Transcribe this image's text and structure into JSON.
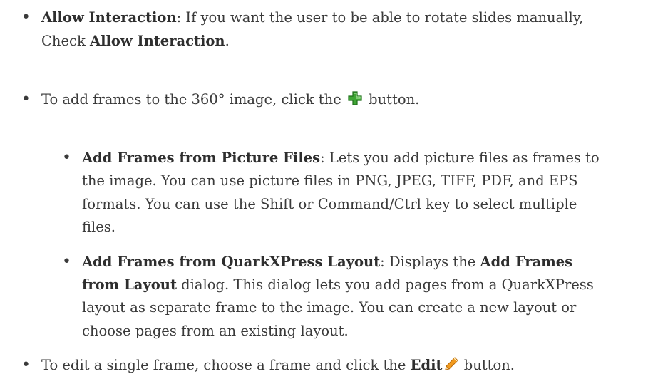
{
  "bullets": {
    "allow_interaction": {
      "label": "Allow Interaction",
      "text_a": ": If you want the user to be able to rotate slides manually,",
      "text_b": "Check ",
      "label2": "Allow Interaction",
      "text_c": "."
    },
    "add_frames": {
      "text_a": "To add frames to the 360° image, click the ",
      "icon": "green-plus-icon",
      "text_b": " button."
    },
    "from_picture_files": {
      "label": "Add Frames from Picture Files",
      "lines": [
        ": Lets you add picture files as frames to",
        "the image. You can use picture files in PNG, JPEG, TIFF, PDF, and EPS",
        "formats. You can use the Shift or Command/Ctrl key to select multiple",
        "files."
      ]
    },
    "from_layout": {
      "label": "Add Frames from QuarkXPress Layout",
      "text_a": ": Displays the ",
      "label2_line1": "Add Frames",
      "label2_line2": "from Layout",
      "text_b": " dialog. This dialog lets you add pages from a QuarkXPress",
      "lines": [
        "layout as separate frame to the image. You can create a new layout or",
        "choose pages from an existing layout."
      ]
    },
    "edit_frame": {
      "text_a": "To edit a single frame, choose a frame and click the ",
      "label": "Edit",
      "icon": "pencil-icon",
      "text_b": " button."
    }
  },
  "colors": {
    "text": "#3a3a3a",
    "plus_green": "#3fa535",
    "pencil_orange": "#f29a1d"
  }
}
